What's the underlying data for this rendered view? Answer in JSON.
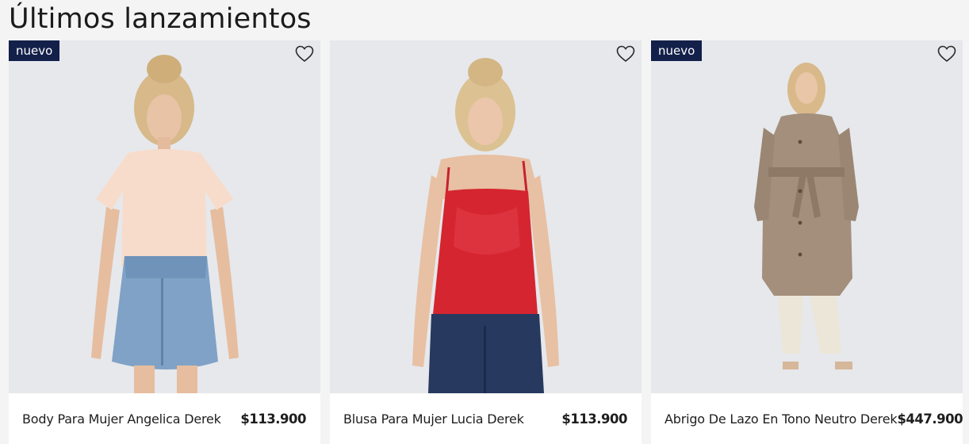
{
  "section": {
    "title": "Últimos lanzamientos"
  },
  "products": [
    {
      "name": "Body Para Mujer Angelica Derek",
      "price": "$113.900",
      "badge": "nuevo"
    },
    {
      "name": "Blusa Para Mujer Lucia Derek",
      "price": "$113.900",
      "badge": ""
    },
    {
      "name": "Abrigo De Lazo En Tono Neutro Derek",
      "price": "$447.900",
      "badge": "nuevo"
    }
  ],
  "icons": {
    "favorite": "heart-outline-icon"
  },
  "colors": {
    "badge_bg": "#13204a",
    "image_bg": "#e6e8ec"
  }
}
